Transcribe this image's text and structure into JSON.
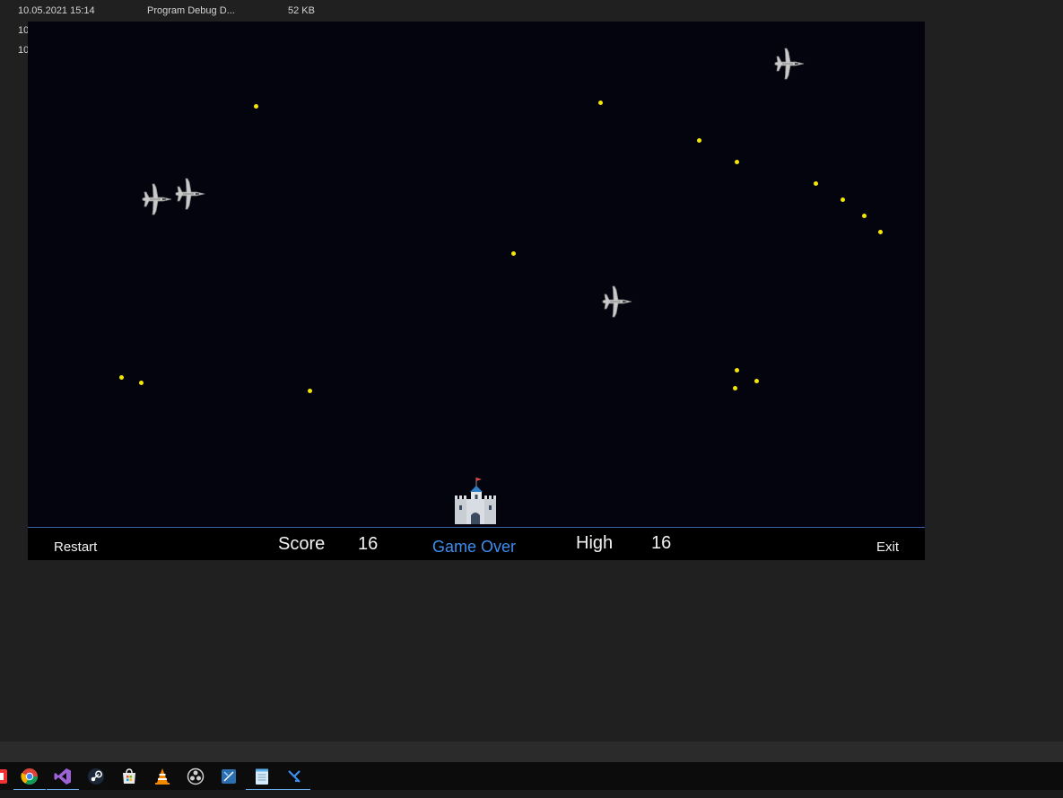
{
  "explorer_row": {
    "date": "10.05.2021 15:14",
    "type": "Program Debug D...",
    "size": "52 KB",
    "row2_fragment": "10",
    "row3_fragment": "10"
  },
  "game": {
    "bullet_color": "#f3e600",
    "background_color": "#04040f",
    "sprites": [
      "fighter-jet-icon",
      "castle-icon"
    ]
  },
  "statusbar": {
    "restart_label": "Restart",
    "score_label": "Score",
    "score_value": "16",
    "game_state": "Game Over",
    "high_label": "High",
    "high_value": "16",
    "exit_label": "Exit"
  },
  "taskbar": {
    "icons": [
      "pdf-icon",
      "chrome-icon",
      "visual-studio-icon",
      "steam-icon",
      "store-icon",
      "vlc-icon",
      "obs-icon",
      "app-icon",
      "notepad-icon",
      "game-app-icon"
    ]
  }
}
